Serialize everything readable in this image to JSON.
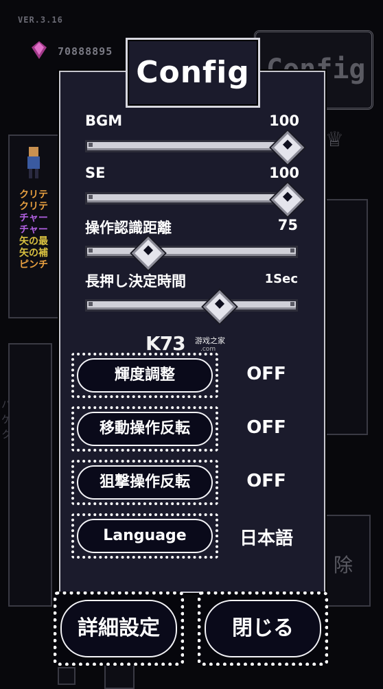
{
  "background": {
    "version": "VER.3.16",
    "coins": "70888895",
    "stats": [
      {
        "text": "クリテ",
        "color": "#e8a040"
      },
      {
        "text": "クリテ",
        "color": "#e8a040"
      },
      {
        "text": "チャー",
        "color": "#b060e0"
      },
      {
        "text": "チャー",
        "color": "#b060e0"
      },
      {
        "text": "矢の最",
        "color": "#d8c040"
      },
      {
        "text": "矢の補",
        "color": "#d8c040"
      },
      {
        "text": "ピンチ",
        "color": "#e8a040"
      }
    ],
    "jp_lines": [
      "バーを",
      "ゲート",
      "クセス"
    ],
    "config_label": "Config",
    "release_text": "除"
  },
  "dialog": {
    "title": "Config",
    "sliders": [
      {
        "label": "BGM",
        "value": "100",
        "level": 1.0
      },
      {
        "label": "SE",
        "value": "100",
        "level": 1.0
      },
      {
        "label": "操作認識距離",
        "value": "75",
        "level": 0.3
      },
      {
        "label": "長押し決定時間",
        "value": "1Sec",
        "level": 0.65
      }
    ],
    "toggles": [
      {
        "label": "輝度調整",
        "state": "OFF"
      },
      {
        "label": "移動操作反転",
        "state": "OFF"
      },
      {
        "label": "狙撃操作反転",
        "state": "OFF"
      },
      {
        "label": "Language",
        "state": "日本語"
      }
    ],
    "buttons": {
      "advanced": "詳細設定",
      "close": "閉じる"
    }
  },
  "watermark": {
    "logo": "K73",
    "tagline": "游戏之家",
    "url": ".com"
  }
}
